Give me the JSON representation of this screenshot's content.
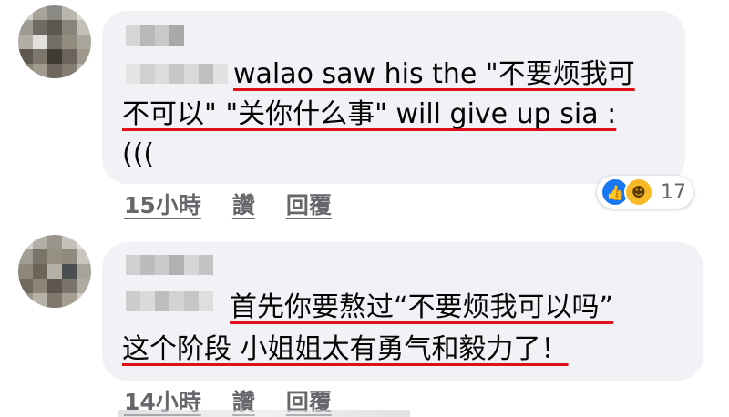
{
  "comments": [
    {
      "lines": [
        "walao saw his the \"不要烦我可",
        "不可以\" \"关你什么事\" will give up sia :",
        "((("
      ],
      "time": "15小時",
      "like_label": "讚",
      "reply_label": "回覆",
      "reaction_count": "17",
      "reaction_icons": [
        "like-icon",
        "haha-icon"
      ]
    },
    {
      "lines": [
        "首先你要熬过“不要烦我可以吗”",
        "这个阶段 小姐姐太有勇气和毅力了！"
      ],
      "time": "14小時",
      "like_label": "讚",
      "reply_label": "回覆"
    }
  ],
  "colors": {
    "bubble": "#f0f2f5",
    "underline": "#e0101a",
    "meta": "#65676b",
    "like": "#1877f2",
    "haha": "#f7b928"
  }
}
